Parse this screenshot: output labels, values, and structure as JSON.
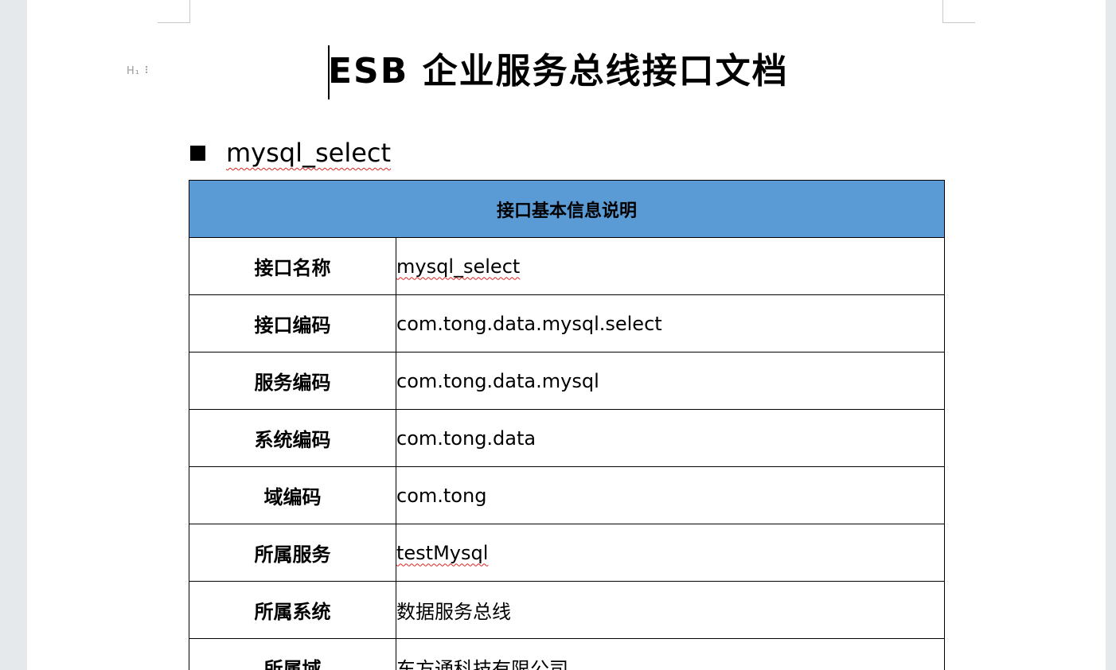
{
  "document": {
    "title": "ESB 企业服务总线接口文档",
    "heading_handle": "H₁ ⠇",
    "section_title": "mysql_select"
  },
  "table": {
    "header": "接口基本信息说明",
    "rows": [
      {
        "label": "接口名称",
        "value": "mysql_select"
      },
      {
        "label": "接口编码",
        "value": "com.tong.data.mysql.select"
      },
      {
        "label": "服务编码",
        "value": "com.tong.data.mysql"
      },
      {
        "label": "系统编码",
        "value": "com.tong.data"
      },
      {
        "label": "域编码",
        "value": "com.tong"
      },
      {
        "label": "所属服务",
        "value": "testMysql"
      },
      {
        "label": "所属系统",
        "value": "数据服务总线"
      },
      {
        "label": "所属域",
        "value": "东方通科技有限公司"
      }
    ]
  }
}
